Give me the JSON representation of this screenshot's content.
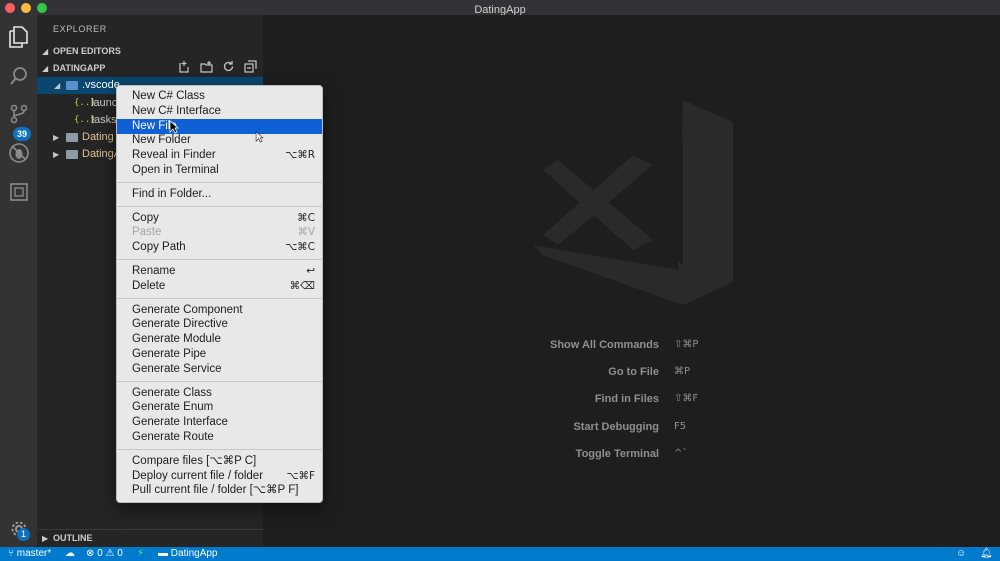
{
  "window": {
    "title": "DatingApp"
  },
  "activity": {
    "scm_badge": "39",
    "settings_badge": "1"
  },
  "sidebar": {
    "header": "EXPLORER",
    "open_editors": "OPEN EDITORS",
    "project": "DATINGAPP",
    "outline": "OUTLINE",
    "tree": [
      {
        "label": ".vscode",
        "kind": "folder-open"
      },
      {
        "label": "launc",
        "kind": "json"
      },
      {
        "label": "tasks",
        "kind": "json"
      },
      {
        "label": "Dating",
        "kind": "folder"
      },
      {
        "label": "DatingA",
        "kind": "folder"
      }
    ]
  },
  "context_menu": {
    "groups": [
      [
        {
          "label": "New C# Class",
          "shortcut": ""
        },
        {
          "label": "New C# Interface",
          "shortcut": ""
        },
        {
          "label": "New File",
          "shortcut": "",
          "highlighted": true
        },
        {
          "label": "New Folder",
          "shortcut": ""
        },
        {
          "label": "Reveal in Finder",
          "shortcut": "⌥⌘R"
        },
        {
          "label": "Open in Terminal",
          "shortcut": ""
        }
      ],
      [
        {
          "label": "Find in Folder...",
          "shortcut": ""
        }
      ],
      [
        {
          "label": "Copy",
          "shortcut": "⌘C"
        },
        {
          "label": "Paste",
          "shortcut": "⌘V",
          "disabled": true
        },
        {
          "label": "Copy Path",
          "shortcut": "⌥⌘C"
        }
      ],
      [
        {
          "label": "Rename",
          "shortcut": "↩"
        },
        {
          "label": "Delete",
          "shortcut": "⌘⌫"
        }
      ],
      [
        {
          "label": "Generate Component",
          "shortcut": ""
        },
        {
          "label": "Generate Directive",
          "shortcut": ""
        },
        {
          "label": "Generate Module",
          "shortcut": ""
        },
        {
          "label": "Generate Pipe",
          "shortcut": ""
        },
        {
          "label": "Generate Service",
          "shortcut": ""
        }
      ],
      [
        {
          "label": "Generate Class",
          "shortcut": ""
        },
        {
          "label": "Generate Enum",
          "shortcut": ""
        },
        {
          "label": "Generate Interface",
          "shortcut": ""
        },
        {
          "label": "Generate Route",
          "shortcut": ""
        }
      ],
      [
        {
          "label": "Compare files [⌥⌘P C]",
          "shortcut": ""
        },
        {
          "label": "Deploy current file / folder",
          "shortcut": "⌥⌘F"
        },
        {
          "label": "Pull current file / folder [⌥⌘P F]",
          "shortcut": ""
        }
      ]
    ]
  },
  "editor": {
    "hints": [
      {
        "label": "Show All Commands",
        "keys": "⇧⌘P"
      },
      {
        "label": "Go to File",
        "keys": "⌘P"
      },
      {
        "label": "Find in Files",
        "keys": "⇧⌘F"
      },
      {
        "label": "Start Debugging",
        "keys": "F5"
      },
      {
        "label": "Toggle Terminal",
        "keys": "^`"
      }
    ]
  },
  "statusbar": {
    "branch": "master*",
    "errors": "0",
    "warnings": "0",
    "folder": "DatingApp"
  },
  "colors": {
    "accent": "#007acc",
    "menu_highlight": "#0f5fd5",
    "selection": "#094771"
  }
}
